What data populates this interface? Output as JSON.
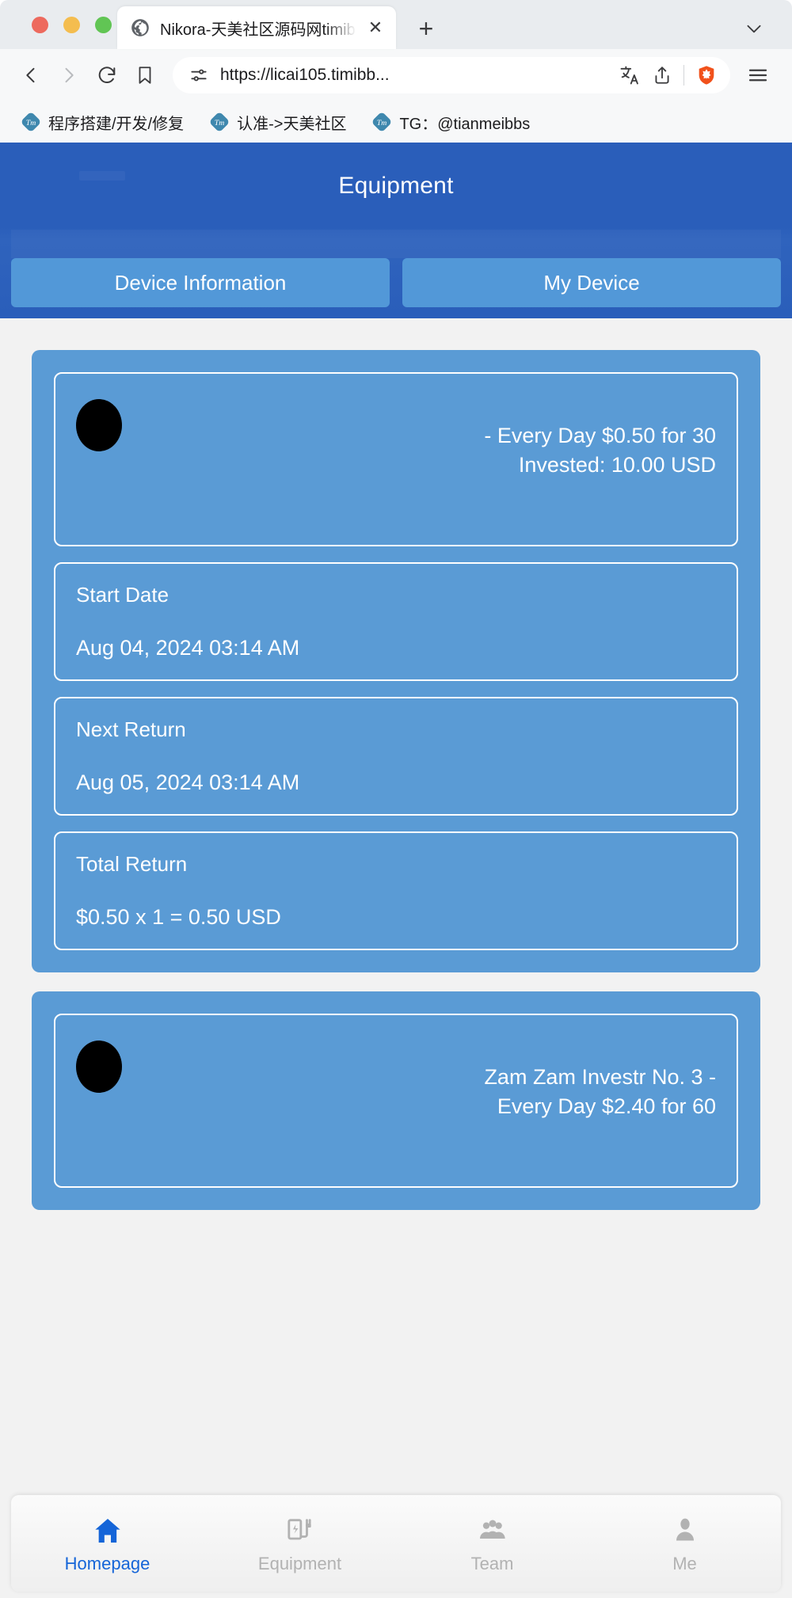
{
  "browser": {
    "window_controls": [
      "close",
      "minimize",
      "maximize"
    ],
    "tab": {
      "title": "Nikora-天美社区源码网timibbs",
      "favicon": "globe-icon",
      "close_label": "✕"
    },
    "new_tab_label": "+",
    "toolbar": {
      "back": "back-icon",
      "forward": "forward-icon",
      "reload": "reload-icon",
      "bookmark": "bookmark-icon",
      "url": "https://licai105.timibb...",
      "permissions": "site-settings-icon",
      "translate": "translate-icon",
      "share": "share-icon",
      "shields": "brave-shields-icon",
      "menu": "hamburger-menu-icon"
    },
    "bookmarks": [
      {
        "label": "程序搭建/开发/修复",
        "icon": "tm-icon"
      },
      {
        "label": "认准->天美社区",
        "icon": "tm-icon"
      },
      {
        "label": "TG：@tianmeibbs",
        "icon": "tm-icon"
      }
    ]
  },
  "app": {
    "header": {
      "title": "Equipment",
      "tabs": [
        {
          "label": "Device Information",
          "active": true
        },
        {
          "label": "My Device",
          "active": false
        }
      ]
    },
    "cards": [
      {
        "thumbnail": "product-image",
        "product_text": "- Every Day $0.50 for 30\nInvested: 10.00 USD",
        "product_lines": [
          "- Every Day $0.50 for 30",
          "Invested: 10.00 USD"
        ],
        "fields": [
          {
            "label": "Start Date",
            "value": "Aug 04, 2024 03:14 AM"
          },
          {
            "label": "Next Return",
            "value": "Aug 05, 2024 03:14 AM"
          },
          {
            "label": "Total Return",
            "value": "$0.50 x 1 = 0.50 USD"
          }
        ]
      },
      {
        "thumbnail": "product-image",
        "product_text": "Zam Zam Investr No. 3 - Every Day $2.40 for 60",
        "product_lines": [
          "Zam Zam Investr No. 3 -",
          "Every Day $2.40 for 60"
        ],
        "fields": []
      }
    ],
    "bottom_nav": [
      {
        "label": "Homepage",
        "icon": "home-icon",
        "active": true
      },
      {
        "label": "Equipment",
        "icon": "ev-charger-icon",
        "active": false
      },
      {
        "label": "Team",
        "icon": "people-icon",
        "active": false
      },
      {
        "label": "Me",
        "icon": "person-icon",
        "active": false
      }
    ]
  },
  "colors": {
    "header_blue": "#2a5eba",
    "segment_blue": "#5298d8",
    "card_blue": "#5a9bd5",
    "page_bg": "#f2f2f2",
    "active_nav": "#1565d8",
    "inactive_nav": "#b2b2b2"
  }
}
